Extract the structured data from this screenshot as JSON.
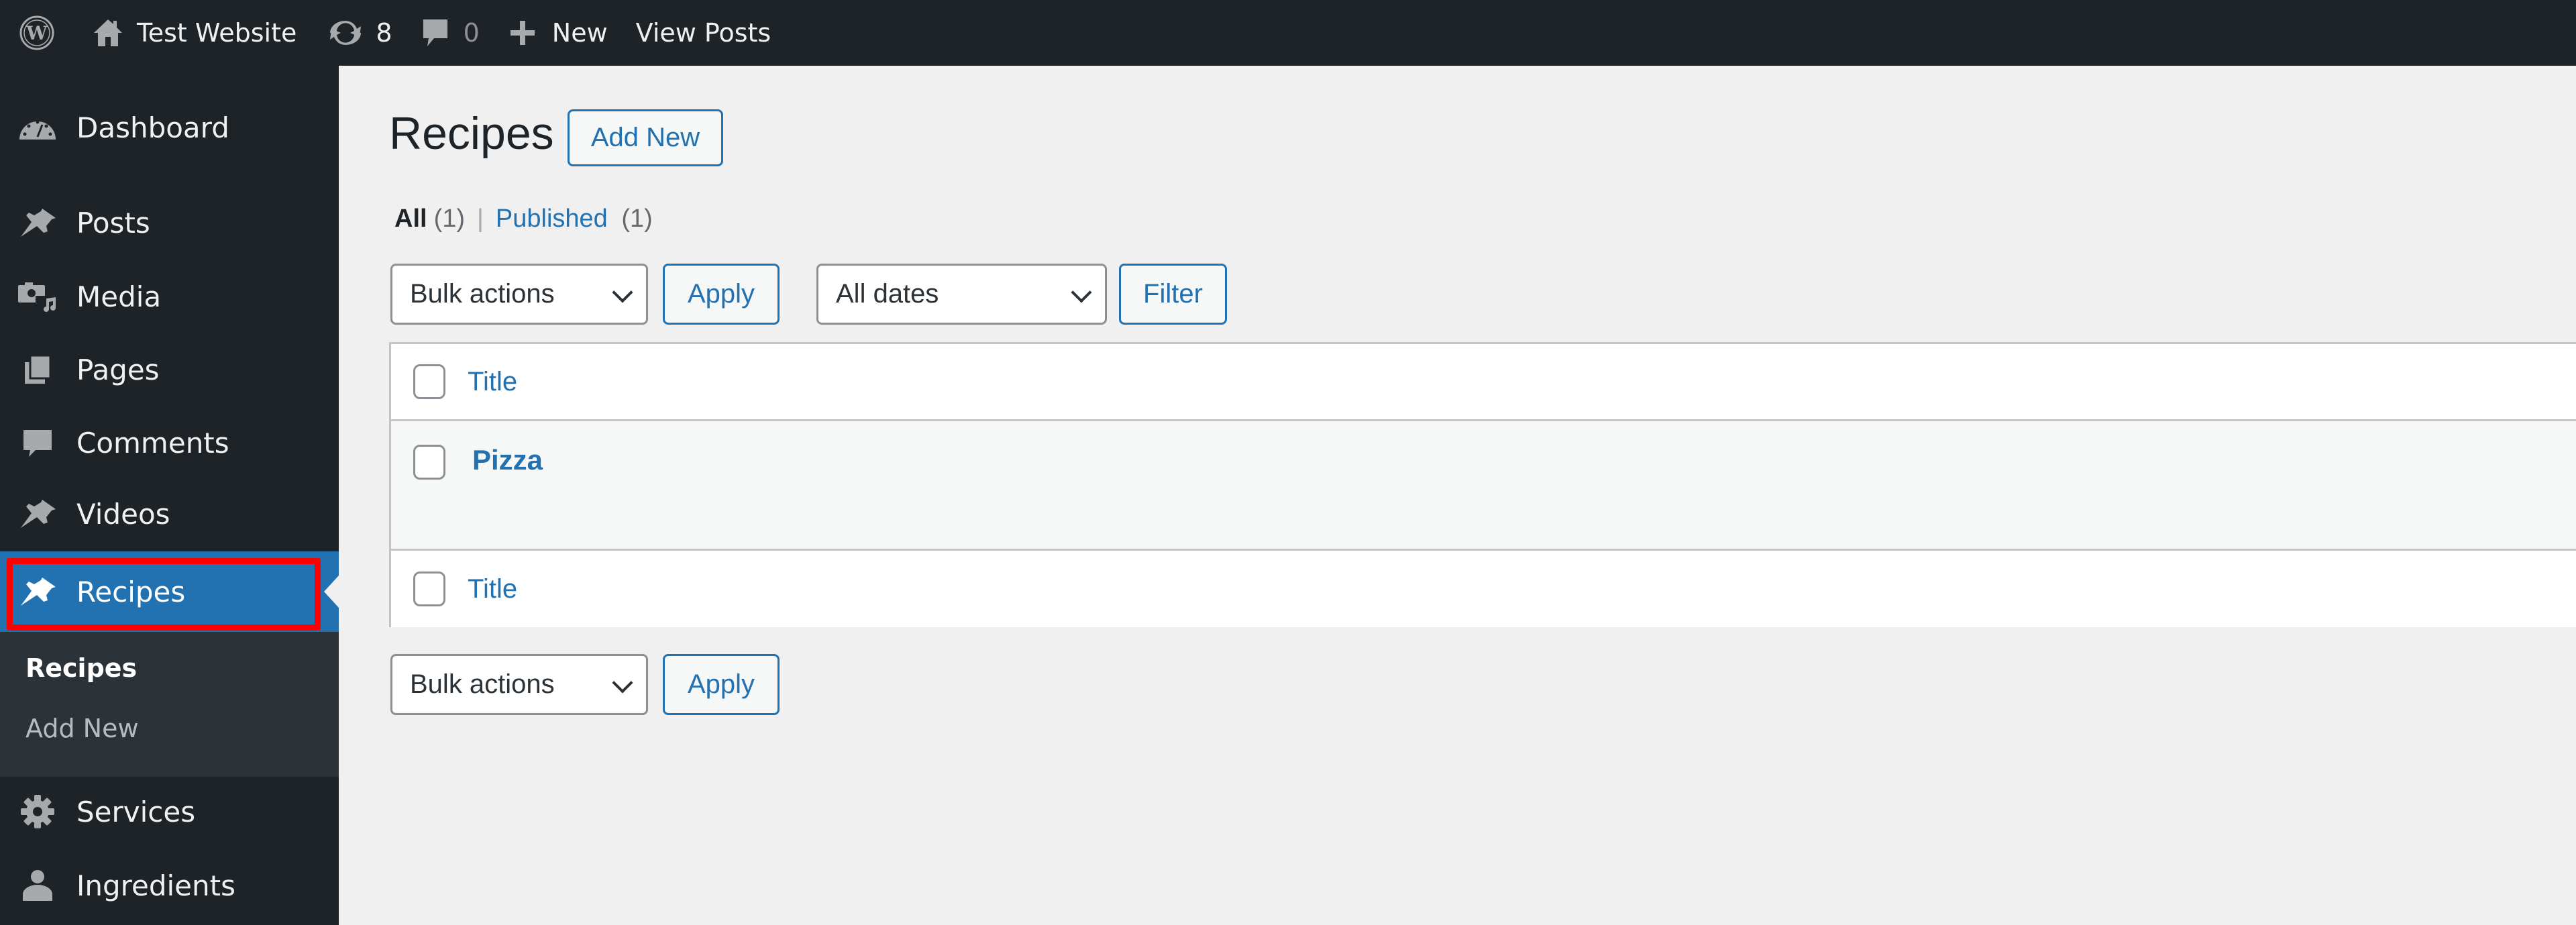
{
  "adminbar": {
    "site_name": "Test Website",
    "updates_count": "8",
    "comments_count": "0",
    "new_label": "New",
    "view_posts_label": "View Posts",
    "icons": [
      "wordpress-logo-icon",
      "home-icon",
      "updates-icon",
      "comment-icon",
      "plus-icon"
    ]
  },
  "sidebar": {
    "items": [
      {
        "label": "Dashboard",
        "icon": "dashboard-icon"
      },
      {
        "label": "Posts",
        "icon": "pushpin-icon"
      },
      {
        "label": "Media",
        "icon": "media-icon"
      },
      {
        "label": "Pages",
        "icon": "pages-icon"
      },
      {
        "label": "Comments",
        "icon": "comment-icon"
      },
      {
        "label": "Videos",
        "icon": "pushpin-icon"
      },
      {
        "label": "Recipes",
        "icon": "pushpin-icon",
        "current": true
      },
      {
        "label": "Services",
        "icon": "gear-icon"
      },
      {
        "label": "Ingredients",
        "icon": "user-icon"
      }
    ],
    "submenu": [
      {
        "label": "Recipes",
        "current": true
      },
      {
        "label": "Add New"
      }
    ]
  },
  "main": {
    "page_title": "Recipes",
    "add_new_label": "Add New",
    "views": {
      "all_label": "All",
      "all_count": "(1)",
      "separator": "|",
      "published_label": "Published",
      "published_count": "(1)"
    },
    "top_toolbar": {
      "bulk_actions_value": "Bulk actions",
      "apply_label": "Apply",
      "dates_value": "All dates",
      "filter_label": "Filter"
    },
    "table": {
      "header_title": "Title",
      "footer_title": "Title",
      "rows": [
        {
          "title": "Pizza"
        }
      ]
    },
    "bottom_toolbar": {
      "bulk_actions_value": "Bulk actions",
      "apply_label": "Apply"
    }
  },
  "colors": {
    "adminbar_bg": "#1d2327",
    "sidebar_bg": "#1d2327",
    "submenu_bg": "#2c3338",
    "accent": "#2271b1",
    "page_bg": "#f0f0f1",
    "highlight_box": "#ff0000"
  }
}
